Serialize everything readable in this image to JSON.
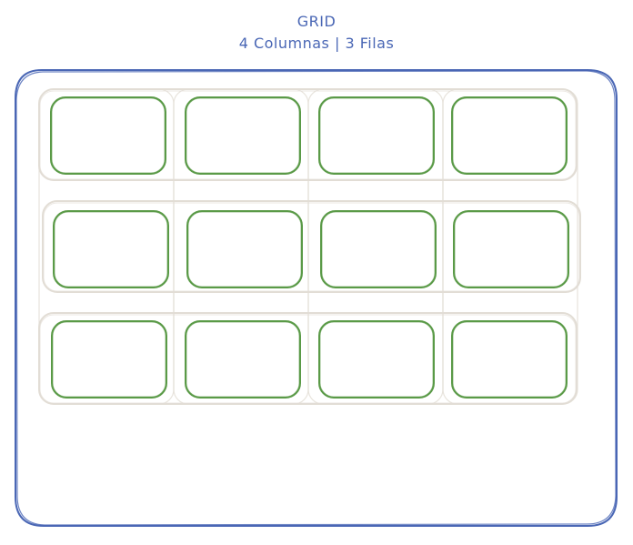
{
  "title": {
    "line1": "GRID",
    "line2": "4 Columnas | 3 Filas"
  },
  "grid": {
    "columns": 4,
    "rows": 3
  },
  "colors": {
    "text": "#4a67b5",
    "container_stroke": "#4a67b5",
    "track_stroke": "#e2ddd5",
    "cell_stroke": "#5a9a47"
  }
}
